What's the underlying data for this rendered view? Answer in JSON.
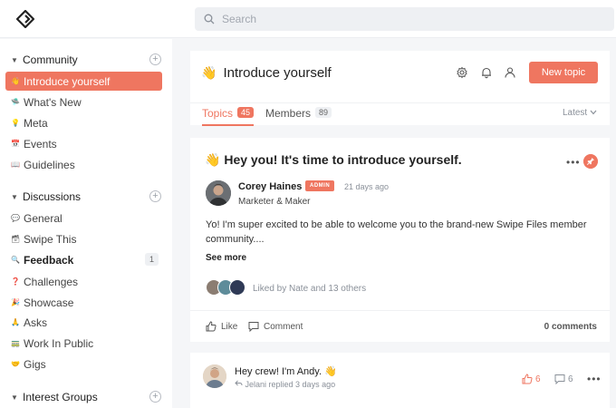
{
  "topbar": {
    "search_placeholder": "Search"
  },
  "sidebar": {
    "groups": [
      {
        "label": "Community",
        "items": [
          {
            "emoji": "👋",
            "label": "Introduce yourself",
            "active": true
          },
          {
            "emoji": "🛸",
            "label": "What's New"
          },
          {
            "emoji": "💡",
            "label": "Meta"
          },
          {
            "emoji": "📅",
            "label": "Events"
          },
          {
            "emoji": "📖",
            "label": "Guidelines"
          }
        ]
      },
      {
        "label": "Discussions",
        "items": [
          {
            "emoji": "💬",
            "label": "General"
          },
          {
            "emoji": "🗃",
            "label": "Swipe This"
          },
          {
            "emoji": "🔍",
            "label": "Feedback",
            "count": "1"
          },
          {
            "emoji": "❓",
            "label": "Challenges"
          },
          {
            "emoji": "🎉",
            "label": "Showcase"
          },
          {
            "emoji": "🙏",
            "label": "Asks"
          },
          {
            "emoji": "🚃",
            "label": "Work In Public"
          },
          {
            "emoji": "🤝",
            "label": "Gigs"
          }
        ]
      },
      {
        "label": "Interest Groups",
        "items": []
      }
    ]
  },
  "header": {
    "emoji": "👋",
    "title": "Introduce yourself",
    "new_topic_label": "New topic",
    "tabs": [
      {
        "label": "Topics",
        "count": "45",
        "active": true
      },
      {
        "label": "Members",
        "count": "89",
        "active": false
      }
    ],
    "sort_label": "Latest"
  },
  "post": {
    "emoji": "👋",
    "title": "Hey you! It's time to introduce yourself.",
    "author": "Corey Haines",
    "badge": "ADMIN",
    "time": "21 days ago",
    "role": "Marketer & Maker",
    "body": "Yo! I'm super excited to be able to welcome you to the brand-new Swipe Files member community....",
    "see_more": "See more",
    "liked_by": "Liked by Nate and 13 others",
    "like_label": "Like",
    "comment_label": "Comment",
    "comments_count": "0 comments"
  },
  "post2": {
    "title": "Hey crew! I'm Andy. 👋",
    "sub": "Jelani replied 3 days ago",
    "likes": "6",
    "comments": "6"
  },
  "colors": {
    "accent": "#ef7660"
  }
}
